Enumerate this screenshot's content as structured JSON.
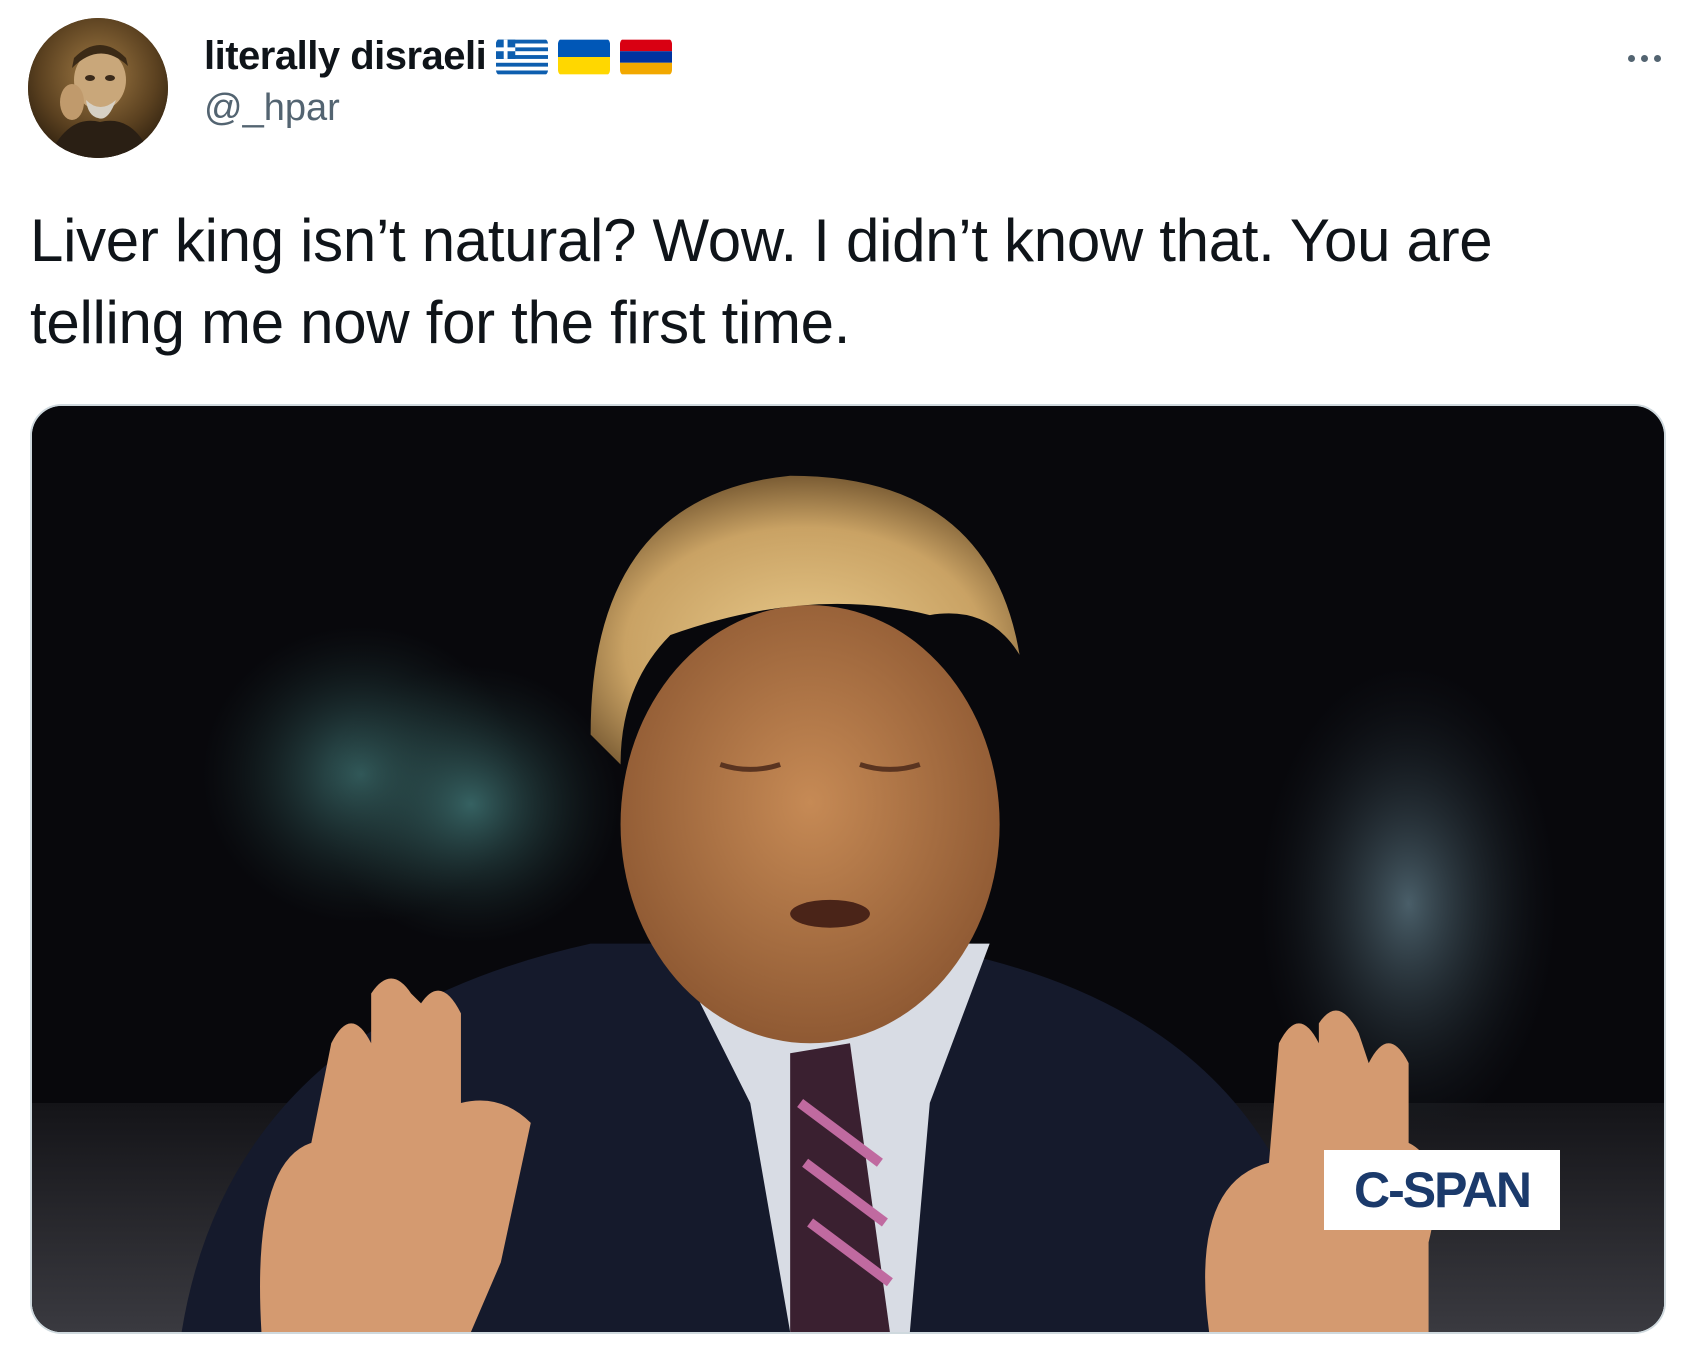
{
  "author": {
    "display_name": "literally disraeli",
    "handle": "@_hpar",
    "flags": [
      "greece-flag-icon",
      "ukraine-flag-icon",
      "armenia-flag-icon"
    ]
  },
  "tweet": {
    "text": "Liver king isn’t natural? Wow. I didn’t know that. You are telling me now for the first time."
  },
  "media": {
    "watermark": "C-SPAN"
  },
  "colors": {
    "text_primary": "#0f1419",
    "text_secondary": "#536471",
    "border": "#cfd9de",
    "cspan_blue": "#1b3a6b"
  }
}
